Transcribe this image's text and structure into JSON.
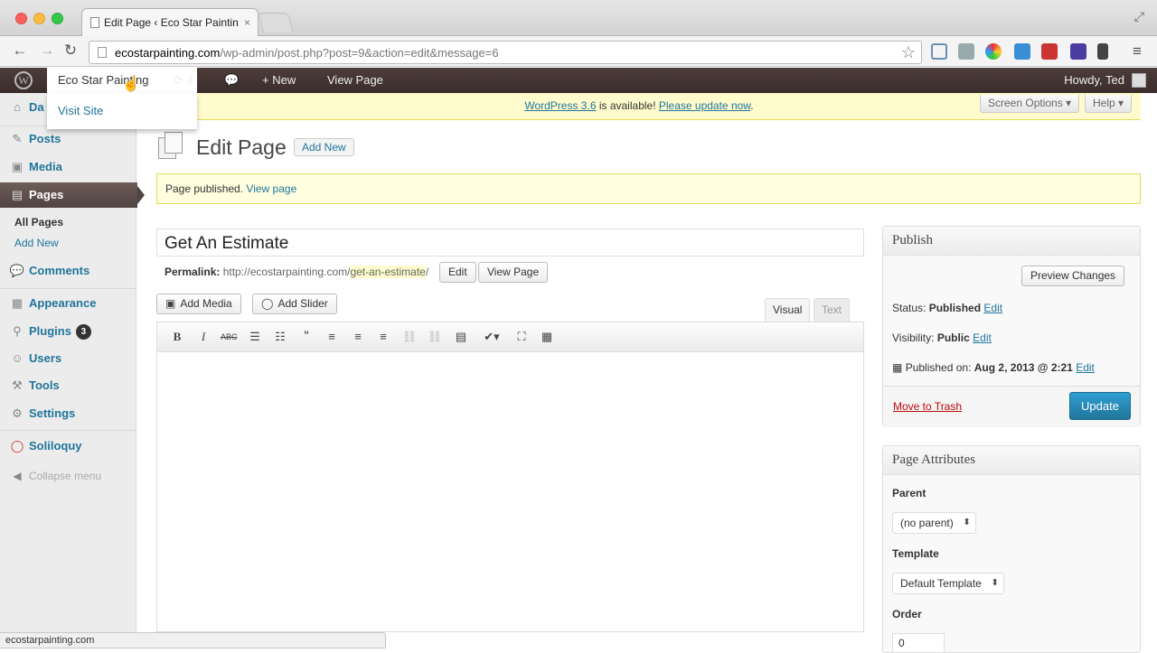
{
  "browser": {
    "tab_title": "Edit Page ‹ Eco Star Paintin",
    "tab_close": "×",
    "url_host": "ecostarpainting.com",
    "url_path": "/wp-admin/post.php?post=9&action=edit&message=6",
    "status_url": "ecostarpainting.com"
  },
  "adminbar": {
    "logo": "W",
    "site_name": "Eco Star Painting",
    "updates": "⟳ 4",
    "new": "+ New",
    "view_page": "View Page",
    "howdy": "Howdy, Ted",
    "dropdown_visit": "Visit Site"
  },
  "sidebar": {
    "dashboard": "Da",
    "posts": "Posts",
    "media": "Media",
    "pages": "Pages",
    "pages_sub": [
      "All Pages",
      "Add New"
    ],
    "comments": "Comments",
    "appearance": "Appearance",
    "plugins": "Plugins",
    "plugins_badge": "3",
    "users": "Users",
    "tools": "Tools",
    "settings": "Settings",
    "soliloquy": "Soliloquy",
    "collapse": "Collapse menu"
  },
  "notice": {
    "version_link": "WordPress 3.6",
    "middle": " is available! ",
    "update_link": "Please update now",
    "end": "."
  },
  "screen_options": "Screen Options ▾",
  "help": "Help ▾",
  "page": {
    "title": "Edit Page",
    "add_new": "Add New",
    "published_msg": "Page published.",
    "view_page_link": "View page"
  },
  "editor": {
    "post_title": "Get An Estimate",
    "permalink_label": "Permalink:",
    "permalink_base": "http://ecostarpainting.com/",
    "permalink_slug": "get-an-estimate",
    "permalink_end": "/",
    "edit_btn": "Edit",
    "view_page_btn": "View Page",
    "add_media": "Add Media",
    "add_slider": "Add Slider",
    "tab_visual": "Visual",
    "tab_text": "Text"
  },
  "publish": {
    "heading": "Publish",
    "preview": "Preview Changes",
    "status_label": "Status:",
    "status_value": "Published",
    "visibility_label": "Visibility:",
    "visibility_value": "Public",
    "published_label": "Published on:",
    "published_value": "Aug 2, 2013 @ 2:21",
    "edit": "Edit",
    "trash": "Move to Trash",
    "update": "Update"
  },
  "attributes": {
    "heading": "Page Attributes",
    "parent_label": "Parent",
    "parent_value": "(no parent)",
    "template_label": "Template",
    "template_value": "Default Template",
    "order_label": "Order",
    "order_value": "0"
  }
}
